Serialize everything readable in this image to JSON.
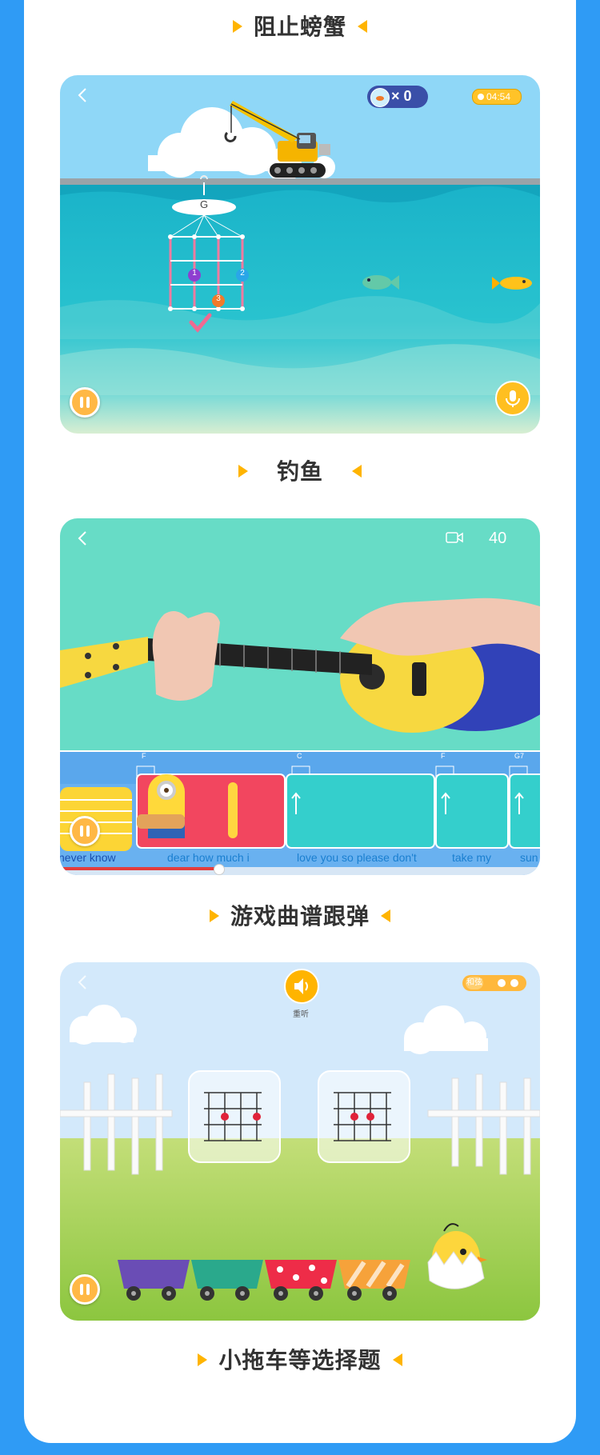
{
  "sections": [
    {
      "title": "阻止螃蟹"
    },
    {
      "title": "钓鱼"
    },
    {
      "title": "游戏曲谱跟弹"
    },
    {
      "title": "小拖车等选择题"
    }
  ],
  "fishing": {
    "fish_count": "× 0",
    "timer": "04:54",
    "chord": "G",
    "fingers": [
      "1",
      "2",
      "3"
    ]
  },
  "song": {
    "score": "40",
    "chord_labels": [
      "F",
      "C",
      "F",
      "G7"
    ],
    "lyrics": [
      "never know",
      "dear how much i",
      "love you so please don't",
      "take my",
      "sun"
    ],
    "progress": 0.33
  },
  "train": {
    "replay_label": "重听",
    "toggle_label": "和弦"
  },
  "colors": {
    "page_bg": "#2f9bf5",
    "accent": "#ffb400",
    "title_text": "#333333"
  }
}
